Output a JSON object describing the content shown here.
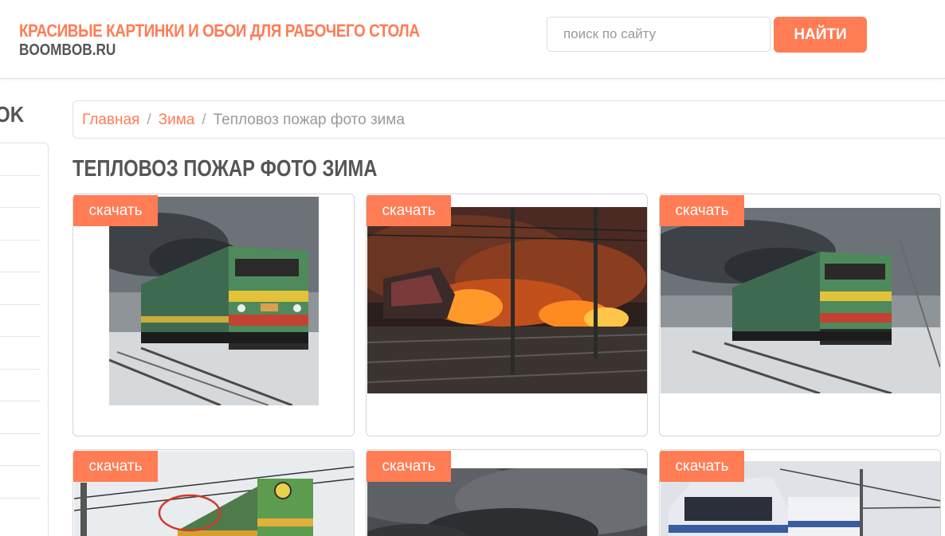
{
  "header": {
    "site_title": "КРАСИВЫЕ КАРТИНКИ И ОБОИ ДЛЯ РАБОЧЕГО СТОЛА",
    "site_domain": "BOOMBOB.RU",
    "search_placeholder": "поиск по сайту",
    "search_button": "НАЙТИ"
  },
  "sidebar": {
    "heading": "OK"
  },
  "breadcrumb": {
    "home": "Главная",
    "category": "Зима",
    "separator": "/",
    "current": "Тепловоз пожар фото зима"
  },
  "page_title": "ТЕПЛОВОЗ ПОЖАР ФОТО ЗИМА",
  "cards": [
    {
      "badge": "скачать",
      "scene": "green-locomotive-winter"
    },
    {
      "badge": "скачать",
      "scene": "train-fire"
    },
    {
      "badge": "скачать",
      "scene": "green-locomotive-winter"
    },
    {
      "badge": "скачать",
      "scene": "electric-locomotive-catenary"
    },
    {
      "badge": "скачать",
      "scene": "dark-smoke-clouds"
    },
    {
      "badge": "скачать",
      "scene": "blue-white-train"
    }
  ],
  "colors": {
    "accent": "#ff7c55",
    "text_dark": "#555555",
    "text_muted": "#999999"
  }
}
